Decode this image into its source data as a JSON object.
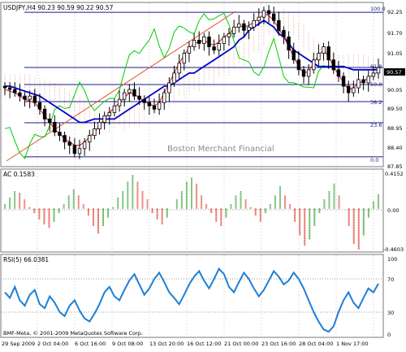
{
  "main": {
    "header": "USDJPY,H4  90.23 90.59 90.22 90.57",
    "watermark": "Boston Merchant Financial",
    "price_ticks": [
      "92.25",
      "91.70",
      "91.05",
      "90.57",
      "90.05",
      "89.50",
      "88.95",
      "88.40",
      "87.85"
    ],
    "fib_labels": [
      "100.0",
      "61.8",
      "50.0",
      "38.2",
      "23.6",
      "0.0"
    ],
    "current_price": "90.57"
  },
  "ac": {
    "header": "AC 0.1583",
    "ticks": [
      "0.4152",
      "0.00",
      "-0.4603"
    ]
  },
  "rsi": {
    "header": "RSI(5) 66.0381",
    "ticks": [
      "100",
      "70",
      "30",
      "0"
    ]
  },
  "footer": {
    "copyright": "BMF-Meta, © 2001-2009 MetaQuotes Software Corp.",
    "date_labels": [
      "29 Sep 2009",
      "2 Oct 04:00",
      "6 Oct 16:00",
      "9 Oct 08:00",
      "13 Oct 20:00",
      "16 Oct 12:00",
      "21 Oct 00:00",
      "23 Oct 16:00",
      "28 Oct 04:00",
      "1 Nov 17:00"
    ]
  },
  "colors": {
    "candles": "#000000",
    "ma_blue": "#0000cc",
    "ma_red": "#e02020",
    "chikou": "#00cc00",
    "kumo": "#cc7755",
    "ac_up": "#2a9a2a",
    "ac_down": "#e03a2a",
    "rsi_line": "#1e7fd6",
    "fib": "#1a1a8a",
    "trendline": "#e05030"
  },
  "chart_data": [
    {
      "type": "candlestick",
      "title": "USDJPY,H4",
      "ylim": [
        87.6,
        92.5
      ],
      "close": [
        89.95,
        89.9,
        89.8,
        89.7,
        89.6,
        89.7,
        89.5,
        89.3,
        89.0,
        88.9,
        88.6,
        88.5,
        88.3,
        88.2,
        87.95,
        88.1,
        88.3,
        88.5,
        88.7,
        88.9,
        89.1,
        89.2,
        89.4,
        89.6,
        89.8,
        89.9,
        89.7,
        89.6,
        89.5,
        89.4,
        89.3,
        89.5,
        89.8,
        90.1,
        90.4,
        90.7,
        91.0,
        91.2,
        91.4,
        91.3,
        91.5,
        91.2,
        91.1,
        91.3,
        91.5,
        91.6,
        91.8,
        91.9,
        91.7,
        91.8,
        92.0,
        92.1,
        92.3,
        92.2,
        92.0,
        91.7,
        91.5,
        91.1,
        90.8,
        90.5,
        90.3,
        90.5,
        90.8,
        91.0,
        91.2,
        90.8,
        90.5,
        90.3,
        90.0,
        89.8,
        89.95,
        90.2,
        90.1,
        90.3,
        90.4,
        90.57
      ],
      "ma_blue": [
        90.0,
        90.0,
        89.95,
        89.9,
        89.85,
        89.8,
        89.75,
        89.7,
        89.6,
        89.5,
        89.4,
        89.3,
        89.2,
        89.1,
        89.0,
        88.9,
        88.9,
        88.95,
        89.0,
        89.0,
        89.0,
        89.0,
        89.0,
        89.1,
        89.2,
        89.3,
        89.4,
        89.5,
        89.6,
        89.7,
        89.8,
        89.9,
        90.0,
        90.0,
        90.1,
        90.2,
        90.3,
        90.4,
        90.4,
        90.5,
        90.6,
        90.7,
        90.8,
        90.9,
        91.0,
        91.1,
        91.2,
        91.4,
        91.5,
        91.7,
        91.8,
        91.9,
        92.0,
        91.9,
        91.8,
        91.6,
        91.5,
        91.3,
        91.1,
        91.0,
        90.9,
        90.8,
        90.7,
        90.6,
        90.6,
        90.6,
        90.6,
        90.6,
        90.6,
        90.55,
        90.5,
        90.5,
        90.5,
        90.5,
        90.5,
        90.5
      ],
      "ma_red": [
        89.9,
        89.85,
        89.8,
        89.7,
        89.6,
        89.55,
        89.5,
        89.3,
        89.1,
        88.9,
        88.7,
        88.55,
        88.4,
        88.3,
        88.2,
        88.2,
        88.3,
        88.45,
        88.6,
        88.8,
        89.0,
        89.2,
        89.35,
        89.5,
        89.65,
        89.8,
        89.75,
        89.65,
        89.55,
        89.45,
        89.4,
        89.5,
        89.8,
        90.1,
        90.4,
        90.7,
        90.95,
        91.15,
        91.3,
        91.35,
        91.4,
        91.3,
        91.25,
        91.35,
        91.5,
        91.6,
        91.75,
        91.85,
        91.8,
        91.85,
        91.95,
        92.05,
        92.2,
        92.15,
        92.0,
        91.75,
        91.5,
        91.2,
        90.9,
        90.6,
        90.4,
        90.45,
        90.7,
        90.95,
        91.1,
        90.9,
        90.6,
        90.35,
        90.1,
        89.9,
        89.95,
        90.1,
        90.15,
        90.25,
        90.35,
        90.45
      ]
    },
    {
      "type": "bar",
      "title": "AC 0.1583",
      "ylim": [
        -0.4603,
        0.4152
      ],
      "values": [
        0.05,
        0.12,
        0.2,
        0.18,
        0.1,
        0.02,
        -0.05,
        -0.12,
        -0.18,
        -0.22,
        -0.15,
        -0.05,
        0.05,
        0.15,
        0.22,
        0.15,
        0.05,
        -0.08,
        -0.2,
        -0.28,
        -0.2,
        -0.1,
        0.02,
        0.12,
        0.2,
        0.3,
        0.38,
        0.3,
        0.2,
        0.1,
        -0.05,
        -0.12,
        -0.18,
        -0.1,
        0.0,
        0.1,
        0.2,
        0.3,
        0.35,
        0.28,
        0.15,
        0.05,
        -0.05,
        -0.15,
        -0.2,
        -0.1,
        0.05,
        0.15,
        0.2,
        0.1,
        0.02,
        -0.08,
        -0.15,
        -0.05,
        0.05,
        0.15,
        0.25,
        0.15,
        0.05,
        -0.15,
        -0.3,
        -0.42,
        -0.35,
        -0.2,
        -0.05,
        0.1,
        0.2,
        0.28,
        0.15,
        0.0,
        -0.2,
        -0.4,
        -0.46,
        -0.3,
        -0.1,
        0.08,
        0.16
      ],
      "up_color": "#2a9a2a",
      "down_color": "#e03a2a"
    },
    {
      "type": "line",
      "title": "RSI(5) 66.0381",
      "ylim": [
        0,
        100
      ],
      "levels": [
        70,
        30
      ],
      "values": [
        55,
        48,
        62,
        45,
        38,
        52,
        58,
        40,
        35,
        50,
        42,
        30,
        25,
        38,
        45,
        32,
        22,
        18,
        28,
        40,
        55,
        62,
        50,
        45,
        58,
        70,
        78,
        65,
        52,
        60,
        72,
        80,
        68,
        55,
        48,
        40,
        52,
        65,
        75,
        82,
        70,
        60,
        72,
        85,
        78,
        62,
        55,
        68,
        80,
        72,
        60,
        50,
        58,
        70,
        82,
        75,
        65,
        70,
        80,
        72,
        60,
        45,
        30,
        18,
        8,
        5,
        12,
        30,
        45,
        55,
        42,
        35,
        48,
        60,
        55,
        66
      ]
    }
  ]
}
